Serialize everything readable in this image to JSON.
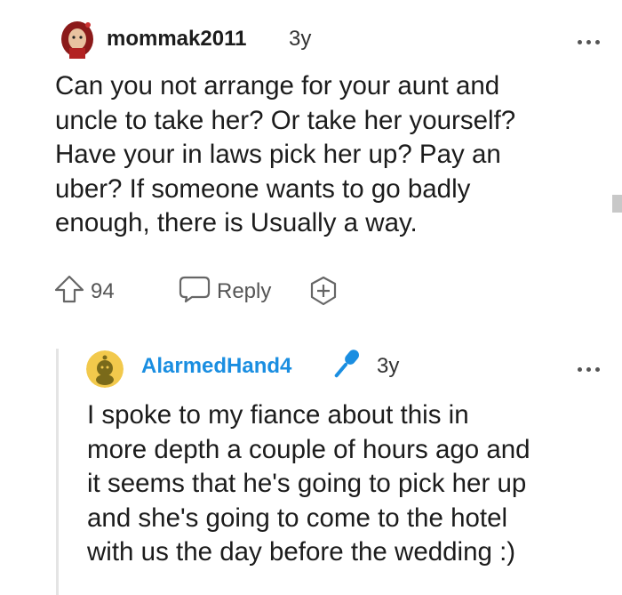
{
  "comment1": {
    "username": "mommak2011",
    "age": "3y",
    "body_lines": [
      "Can you not arrange for your aunt and",
      "uncle to take her? Or take her yourself?",
      "Have your in laws pick her up? Pay an",
      "uber? If someone wants to go badly",
      "enough, there is Usually a way."
    ],
    "vote_count": "94",
    "reply_label": "Reply"
  },
  "comment2": {
    "username": "AlarmedHand4",
    "age": "3y",
    "body_lines": [
      "I spoke to my fiance about this in",
      "more depth a couple of hours ago and",
      "it seems that he's going to pick her up",
      "and she's going to come to the hotel",
      "with us the day before the wedding :)"
    ]
  },
  "icons": {
    "more": "more-options-icon",
    "upvote": "upvote-arrow-icon",
    "reply": "speech-bubble-icon",
    "award": "award-plus-icon",
    "flair": "microphone-icon"
  },
  "colors": {
    "username2": "#1a8ee1",
    "flair": "#1a8ee1",
    "text": "#1c1c1c",
    "muted": "#555555"
  }
}
